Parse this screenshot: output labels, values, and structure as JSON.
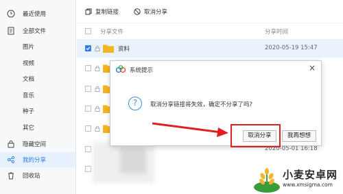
{
  "sidebar": {
    "items": [
      {
        "label": "最近使用",
        "icon": "clock-icon"
      },
      {
        "label": "全部文件",
        "icon": "document-icon"
      },
      {
        "label": "图片"
      },
      {
        "label": "视频"
      },
      {
        "label": "文档"
      },
      {
        "label": "音乐"
      },
      {
        "label": "种子"
      },
      {
        "label": "其它"
      },
      {
        "label": "隐藏空间",
        "icon": "lock-icon"
      },
      {
        "label": "我的分享",
        "icon": "share-icon",
        "active": true
      },
      {
        "label": "回收站",
        "icon": "trash-icon"
      }
    ]
  },
  "toolbar": {
    "copy_link": "复制链接",
    "cancel_share": "取消分享"
  },
  "table": {
    "columns": [
      "分享文件",
      "分享时间"
    ],
    "rows": [
      {
        "name": "资料",
        "time": "2020-05-19 15:47",
        "checked": true
      }
    ],
    "partial_time": "2020-05-01 16:18"
  },
  "dialog": {
    "title": "系统提示",
    "close": "×",
    "question_mark": "?",
    "message": "取消分享链接将失效，确定不分享了吗?",
    "confirm": "取消分享",
    "cancel": "我再想想"
  },
  "watermark": {
    "name": "小麦安卓网",
    "url": "www.xmsigma.com"
  },
  "colors": {
    "accent": "#2f7ee6",
    "folder": "#f5b521",
    "highlight": "#e02020",
    "arrow": "#e02020"
  }
}
